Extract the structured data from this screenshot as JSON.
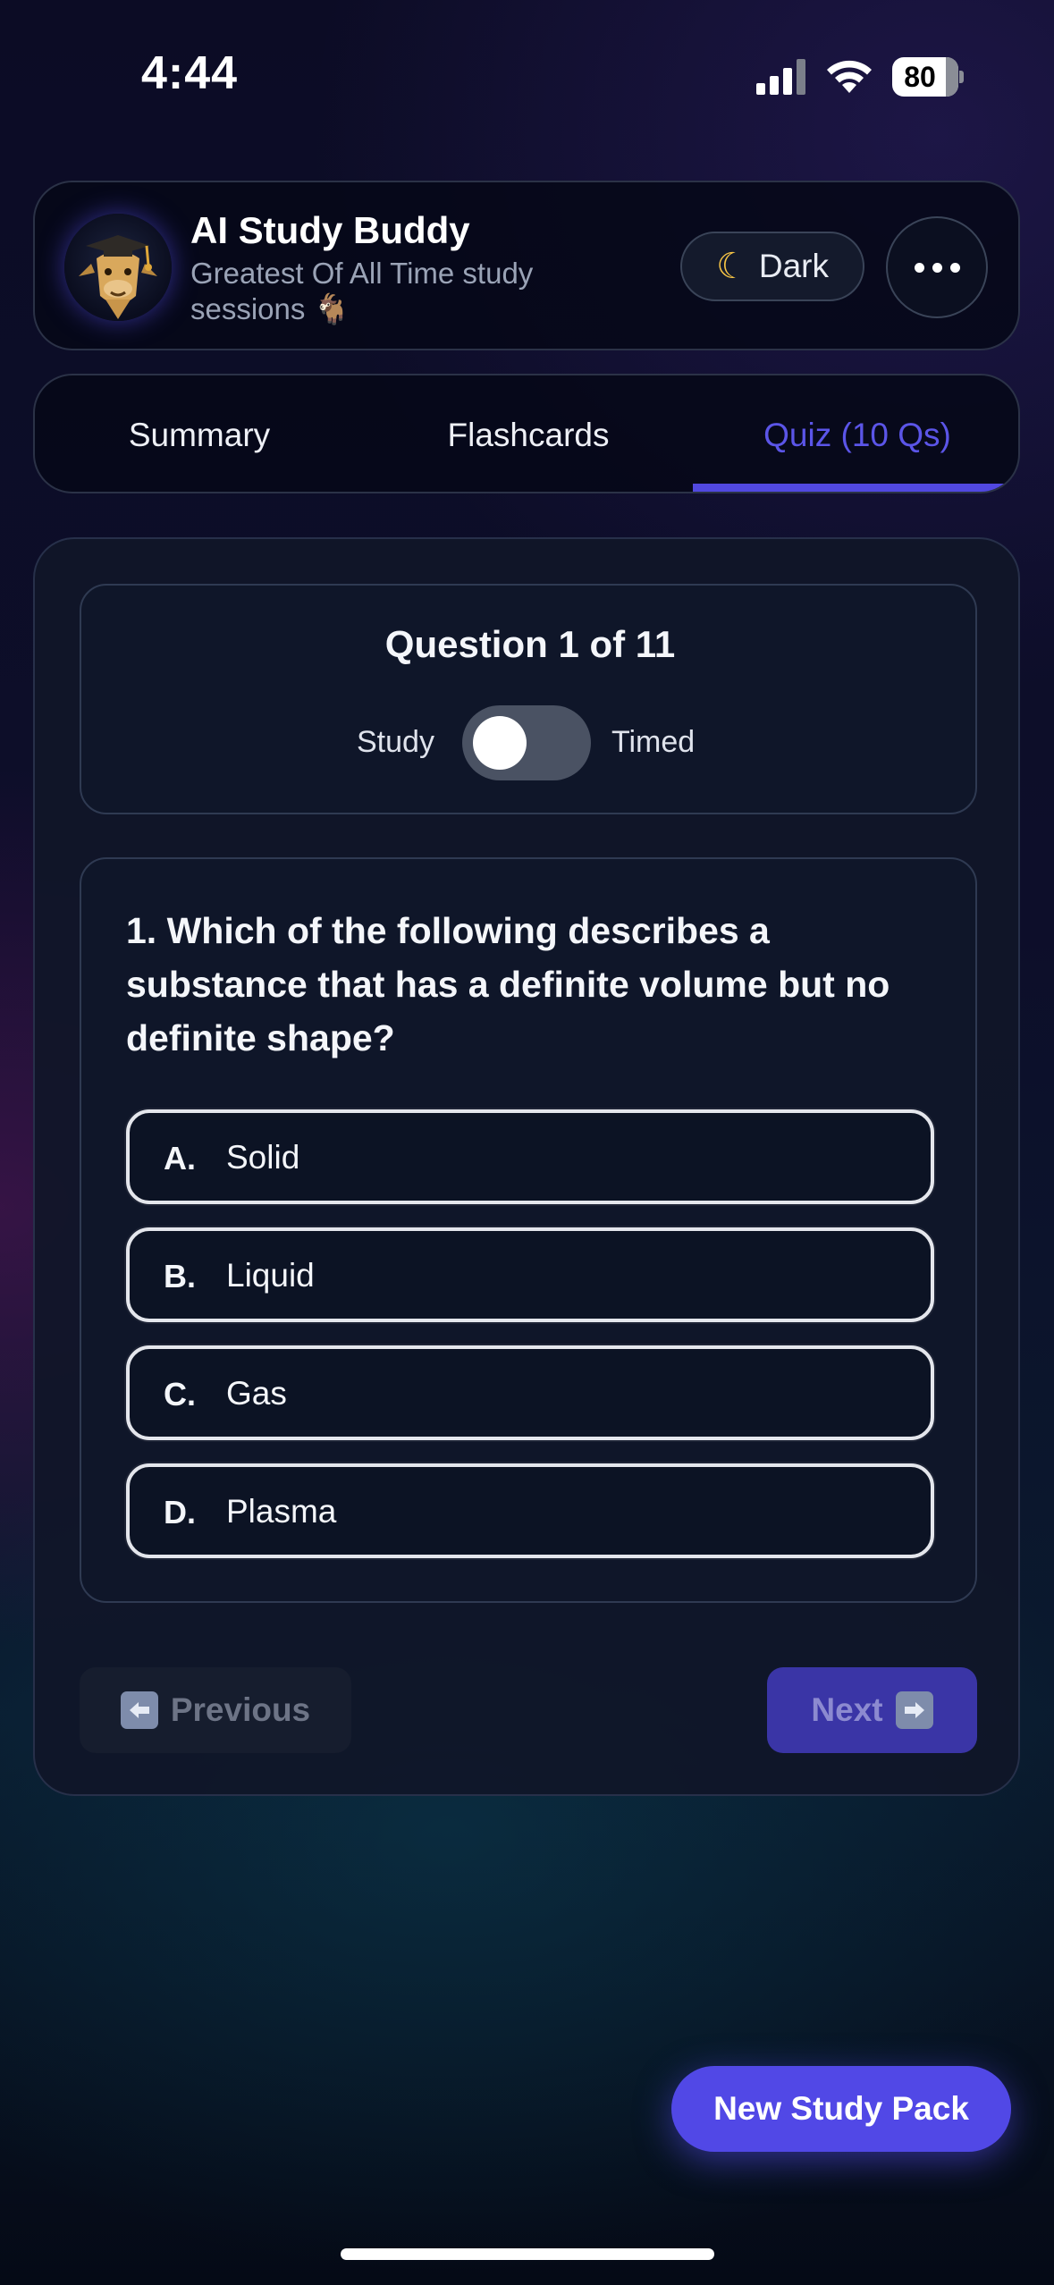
{
  "status_bar": {
    "time": "4:44",
    "battery": "80"
  },
  "header": {
    "title": "AI Study Buddy",
    "subtitle": "Greatest Of All Time study sessions 🐐",
    "theme_button": {
      "icon": "moon-icon",
      "label": "Dark"
    },
    "more_button": {
      "icon": "ellipsis-icon"
    }
  },
  "tabs": [
    {
      "label": "Summary",
      "active": false
    },
    {
      "label": "Flashcards",
      "active": false
    },
    {
      "label": "Quiz (10 Qs)",
      "active": true
    }
  ],
  "quiz": {
    "counter": "Question 1 of 11",
    "mode_left": "Study",
    "mode_right": "Timed",
    "timed_mode_on": false,
    "question": "1. Which of the following describes a substance that has a definite volume but no definite shape?",
    "options": [
      {
        "letter": "A.",
        "text": "Solid"
      },
      {
        "letter": "B.",
        "text": "Liquid"
      },
      {
        "letter": "C.",
        "text": "Gas"
      },
      {
        "letter": "D.",
        "text": "Plasma"
      }
    ],
    "previous_label": "Previous",
    "next_label": "Next"
  },
  "new_pack_label": "New Study Pack",
  "colors": {
    "accent": "#5148e6",
    "active_tab": "#5b55e8",
    "card_bg": "#0f1629",
    "moon": "#f6c445"
  }
}
